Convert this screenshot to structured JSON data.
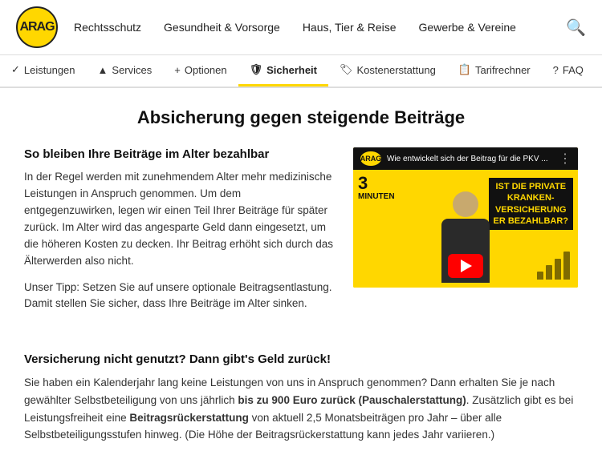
{
  "header": {
    "logo_text": "ARAG",
    "nav_links": [
      {
        "label": "Rechtsschutz"
      },
      {
        "label": "Gesundheit & Vorsorge"
      },
      {
        "label": "Haus, Tier & Reise"
      },
      {
        "label": "Gewerbe & Vereine"
      }
    ]
  },
  "tabs": [
    {
      "label": "Leistungen",
      "icon": "✓",
      "active": false
    },
    {
      "label": "Services",
      "icon": "▲",
      "active": false
    },
    {
      "label": "Optionen",
      "icon": "+",
      "active": false
    },
    {
      "label": "Sicherheit",
      "icon": "🛡",
      "active": true
    },
    {
      "label": "Kostenerstattung",
      "icon": "🏷",
      "active": false
    },
    {
      "label": "Tarifrechner",
      "icon": "📋",
      "active": false
    },
    {
      "label": "FAQ",
      "icon": "?",
      "active": false
    }
  ],
  "page_title": "Absicherung gegen steigende Beiträge",
  "section1": {
    "heading": "So bleiben Ihre Beiträge im Alter bezahlbar",
    "para1": "In der Regel werden mit zunehmendem Alter mehr medizinische Leistungen in Anspruch genommen. Um dem entgegenzuwirken, legen wir einen Teil Ihrer Beiträge für später zurück. Im Alter wird das angesparte Geld dann eingesetzt, um die höheren Kosten zu decken. Ihr Beitrag erhöht sich durch das Älterwerden also nicht.",
    "para2": "Unser Tipp: Setzen Sie auf unsere optionale Beitragsentlastung. Damit stellen Sie sicher, dass Ihre Beiträge im Alter sinken."
  },
  "video": {
    "logo": "ARAG",
    "title": "Wie entwickelt sich der Beitrag für die PKV ...",
    "overlay_line1": "IST DIE PRIVATE",
    "overlay_line2": "KRANKENVERSICHERUNG",
    "overlay_line3": "ER BEZAHLBAR?",
    "text_big": "3"
  },
  "section2": {
    "heading": "Versicherung nicht genutzt? Dann gibt's Geld zurück!",
    "text": "Sie haben ein Kalenderjahr lang keine Leistungen von uns in Anspruch genommen? Dann erhalten Sie je nach gewählter Selbstbeteiligung von uns jährlich ",
    "bold1": "bis zu 900 Euro zurück (Pauschalerstattung)",
    "text2": ". Zusätzlich gibt es bei Leistungsfreiheit eine ",
    "bold2": "Beitragsrückerstattung",
    "text3": " von aktuell 2,5 Monatsbeiträgen pro Jahr – über alle Selbstbeteiligungsstufen hinweg. (Die Höhe der Beitragsrückerstattung kann jedes Jahr variieren.)"
  }
}
